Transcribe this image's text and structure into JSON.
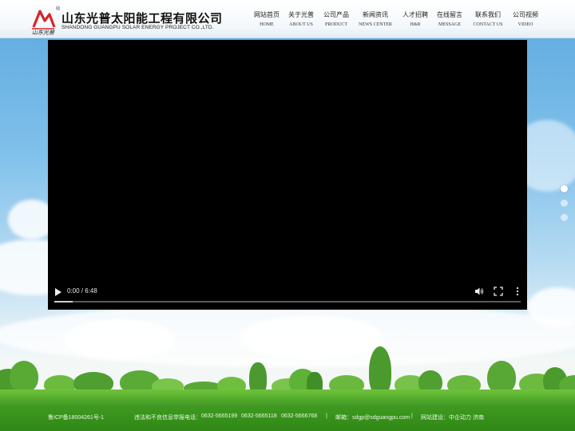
{
  "brand": {
    "name_cn": "山东光普太阳能工程有限公司",
    "name_en": "SHANDONG GUANGPU SOLAR ENERGY PROJECT  CO.,LTD.",
    "logo_script": "山东光普",
    "registered_mark": "®"
  },
  "nav": [
    {
      "cn": "网站首页",
      "en": "HOME"
    },
    {
      "cn": "关于光普",
      "en": "ABOUT US"
    },
    {
      "cn": "公司产品",
      "en": "PRODUCT"
    },
    {
      "cn": "新闻资讯",
      "en": "NEWS CENTER"
    },
    {
      "cn": "人才招聘",
      "en": "H&R"
    },
    {
      "cn": "在线留言",
      "en": "MESSAGE"
    },
    {
      "cn": "联系我们",
      "en": "CONTACT US"
    },
    {
      "cn": "公司视频",
      "en": "VIDEO"
    }
  ],
  "video": {
    "time_display": "0:00 / 6:48",
    "progress_fraction": 0.04
  },
  "slider": {
    "dot_count": 3,
    "active_index": 0
  },
  "footer": {
    "icp": "鲁ICP备18004261号-1",
    "report": "违法和不良信息举报电话：",
    "phone1": "0632-5665199",
    "phone2": "0632-5665118",
    "phone3": "0632-5666768",
    "sep1": "|",
    "email": "邮箱：sdgp@sdguangpu.com",
    "sep2": "|",
    "builder": "网站建设：中企动力  济南"
  },
  "colors": {
    "logo_red": "#d6262b",
    "footer_green": "#3d9a1e"
  },
  "icons": [
    "play-icon",
    "volume-icon",
    "fullscreen-icon",
    "more-options-icon"
  ]
}
